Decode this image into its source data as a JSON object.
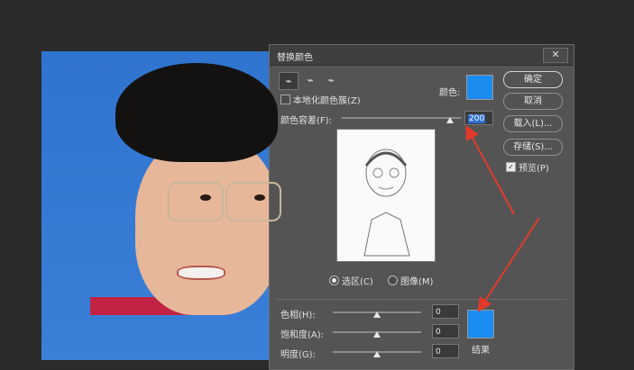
{
  "dialog": {
    "title": "替换颜色",
    "close_glyph": "✕",
    "tools": [
      {
        "icon": "eyedropper-icon",
        "glyph": "⌁"
      },
      {
        "icon": "eyedropper-plus-icon",
        "glyph": "⌁"
      },
      {
        "icon": "eyedropper-minus-icon",
        "glyph": "⌁"
      }
    ],
    "localized_clusters_label": "本地化颜色簇(Z)",
    "localized_clusters_checked": false,
    "color_label": "颜色:",
    "color_value": "#1b8cf0",
    "fuzziness_label": "颜色容差(F):",
    "fuzziness_value": "200",
    "fuzziness_fraction": 0.8,
    "view_options": {
      "selection_label": "选区(C)",
      "image_label": "图像(M)",
      "selected": "selection"
    },
    "hue_label": "色相(H):",
    "hue_value": "0",
    "saturation_label": "饱和度(A):",
    "saturation_value": "0",
    "lightness_label": "明度(G):",
    "lightness_value": "0",
    "result_label": "结果",
    "result_color": "#1b8cf0"
  },
  "buttons": {
    "ok": "确定",
    "cancel": "取消",
    "load": "载入(L)...",
    "save": "存储(S)...",
    "preview_label": "预览(P)",
    "preview_checked": true
  },
  "annotations": {
    "arrow_color": "#e23a2a"
  }
}
